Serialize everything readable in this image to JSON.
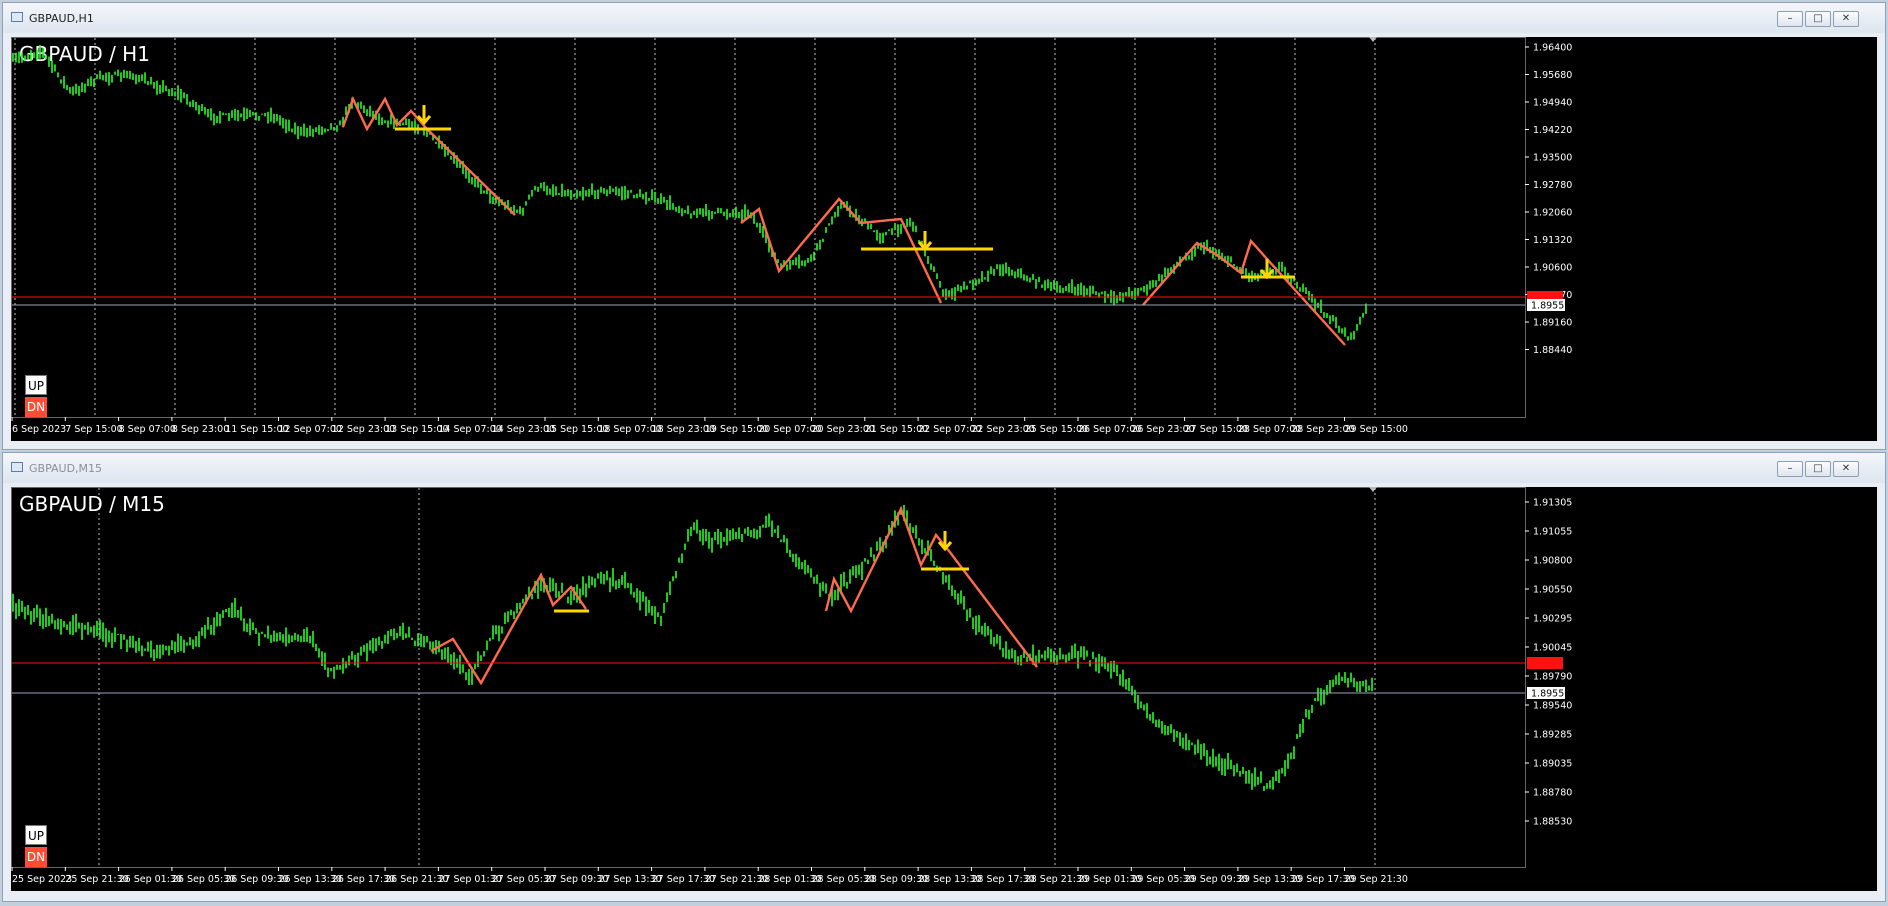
{
  "windows": [
    {
      "title": "GBPAUD,H1",
      "symbol": "GBPAUD / H1",
      "controls": {
        "minimize": "–",
        "maximize": "□",
        "close": "✕"
      },
      "buttons": {
        "up": "UP",
        "dn": "DN"
      },
      "price_axis": [
        "1.96400",
        "1.95680",
        "1.94940",
        "1.94220",
        "1.93500",
        "1.92780",
        "1.92060",
        "1.91320",
        "1.90600",
        "1.89870",
        "1.89160",
        "1.88440"
      ],
      "current_price": "1.89559",
      "red_line_price": "1.89899",
      "time_axis": [
        "6 Sep 2023",
        "7 Sep 15:00",
        "8 Sep 07:00",
        "8 Sep 23:00",
        "11 Sep 15:00",
        "12 Sep 07:00",
        "12 Sep 23:00",
        "13 Sep 15:00",
        "14 Sep 07:00",
        "14 Sep 23:00",
        "15 Sep 15:00",
        "18 Sep 07:00",
        "18 Sep 23:00",
        "19 Sep 15:00",
        "20 Sep 07:00",
        "20 Sep 23:00",
        "21 Sep 15:00",
        "22 Sep 07:00",
        "22 Sep 23:00",
        "25 Sep 15:00",
        "26 Sep 07:00",
        "26 Sep 23:00",
        "27 Sep 15:00",
        "28 Sep 07:00",
        "28 Sep 23:00",
        "29 Sep 15:00"
      ]
    },
    {
      "title": "GBPAUD,M15",
      "symbol": "GBPAUD / M15",
      "controls": {
        "minimize": "–",
        "maximize": "□",
        "close": "✕"
      },
      "buttons": {
        "up": "UP",
        "dn": "DN"
      },
      "price_axis": [
        "1.91305",
        "1.91055",
        "1.90800",
        "1.90550",
        "1.90295",
        "1.90045",
        "1.89790",
        "1.89540",
        "1.89285",
        "1.89035",
        "1.88780",
        "1.88530"
      ],
      "current_price": "1.89559",
      "red_line_price": "1.89899",
      "time_axis": [
        "25 Sep 2023",
        "25 Sep 21:30",
        "26 Sep 01:30",
        "26 Sep 05:30",
        "26 Sep 09:30",
        "26 Sep 13:30",
        "26 Sep 17:30",
        "26 Sep 21:30",
        "27 Sep 01:30",
        "27 Sep 05:30",
        "27 Sep 09:30",
        "27 Sep 13:30",
        "27 Sep 17:30",
        "27 Sep 21:30",
        "28 Sep 01:30",
        "28 Sep 05:30",
        "28 Sep 09:30",
        "28 Sep 13:30",
        "28 Sep 17:30",
        "28 Sep 21:30",
        "29 Sep 01:30",
        "29 Sep 05:30",
        "29 Sep 09:30",
        "29 Sep 13:30",
        "29 Sep 17:30",
        "29 Sep 21:30"
      ]
    }
  ],
  "colors": {
    "candles": "#22ff22",
    "zigzag": "#ff6a4d",
    "level": "#ffd700",
    "arrow": "#ffd700",
    "red_line": "#ff1111",
    "bid_line": "#9aa6b6",
    "grid": "#ffffff"
  }
}
